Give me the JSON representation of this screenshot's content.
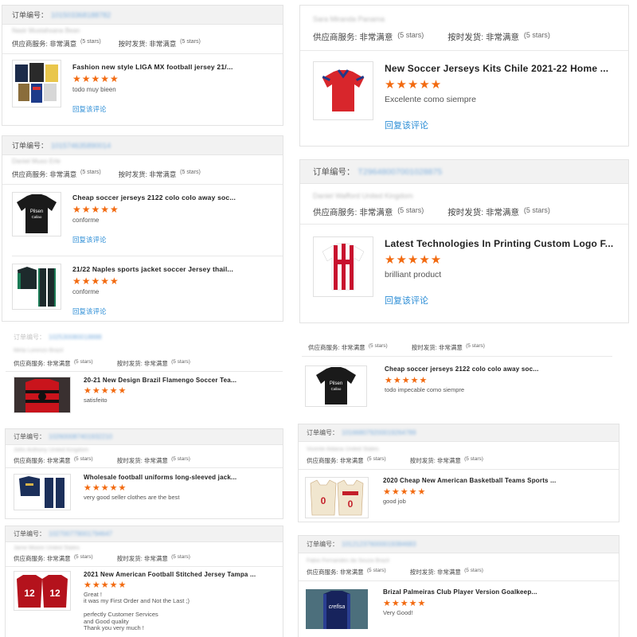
{
  "labels": {
    "order_no": "订单编号：",
    "supplier_service": "供应商服务:",
    "on_time_shipping": "按时发货:",
    "rating_value": "非常满意",
    "rating_note": "(5 stars)",
    "reply": "回复该评论",
    "stars": "★★★★★"
  },
  "panels": {
    "p1": {
      "order_no": "101503368188782",
      "buyer": "Nasir Mustahsana Bean"
    },
    "p2": {
      "buyer": "Sara Miranda Panama"
    },
    "p3": {
      "order_no": "101574635890014",
      "buyer": "Daniel Muso Erle"
    },
    "p4": {
      "order_no": "T29648007001028875",
      "buyer": "Daniel Wafford United Kingdom"
    },
    "p5": {
      "order_no": "102530080018888",
      "buyer": "Mirta Lorenzo Brazil"
    },
    "p7": {
      "order_no": "102600087401932210",
      "buyer": "John Anthony United Kingdom"
    },
    "p8": {
      "order_no": "101668079200019264789",
      "buyer": "Vicente Aldana United States"
    },
    "p9": {
      "order_no": "102700779001794647",
      "buyer": "Jame Moore United States"
    },
    "p10": {
      "order_no": "101212376000019384683",
      "buyer": "Fabio Fernandes da Souza Brazil"
    }
  },
  "reviews": [
    {
      "title": "Fashion new style LIGA MX football jersey 21/...",
      "comment": "todo muy bieen"
    },
    {
      "title": "New Soccer Jerseys Kits Chile 2021-22 Home ...",
      "comment": "Excelente como siempre"
    },
    {
      "title": "Cheap soccer jerseys 2122 colo colo away soc...",
      "comment": "conforme"
    },
    {
      "title": "21/22 Naples sports jacket soccer Jersey thail...",
      "comment": "conforme"
    },
    {
      "title": "Latest Technologies In Printing Custom Logo F...",
      "comment": "brilliant product"
    },
    {
      "title": "20-21 New Design Brazil Flamengo Soccer Tea...",
      "comment": "satisfeito"
    },
    {
      "title": "Cheap soccer jerseys 2122 colo colo away soc...",
      "comment": "todo impecable como siempre"
    },
    {
      "title": "Wholesale football uniforms long-sleeved jack...",
      "comment": "very good seller clothes are the best"
    },
    {
      "title": "2020 Cheap New American Basketball Teams Sports ...",
      "comment": "good job"
    },
    {
      "title": "2021 New American Football Stitched Jersey Tampa ...",
      "comment": "Great !\nit was my First Order and Not the Last ;)\n\nperfectly Customer Services\nand Good quality\nThank you very much !"
    },
    {
      "title": "Brizal Palmeiras Club Player Version Goalkeep...",
      "comment": "Very Good!"
    }
  ],
  "thumb_text": {
    "colo_sponsor_1": "Pilsen",
    "colo_sponsor_2": "Callao",
    "jersey_number": "12",
    "basketball_number": "0",
    "palmeiras_sponsor": "crefisa"
  },
  "colors": {
    "star": "#f26a10",
    "reply_link": "#2d8ed6",
    "order_header_bg": "#f2f2f2"
  }
}
